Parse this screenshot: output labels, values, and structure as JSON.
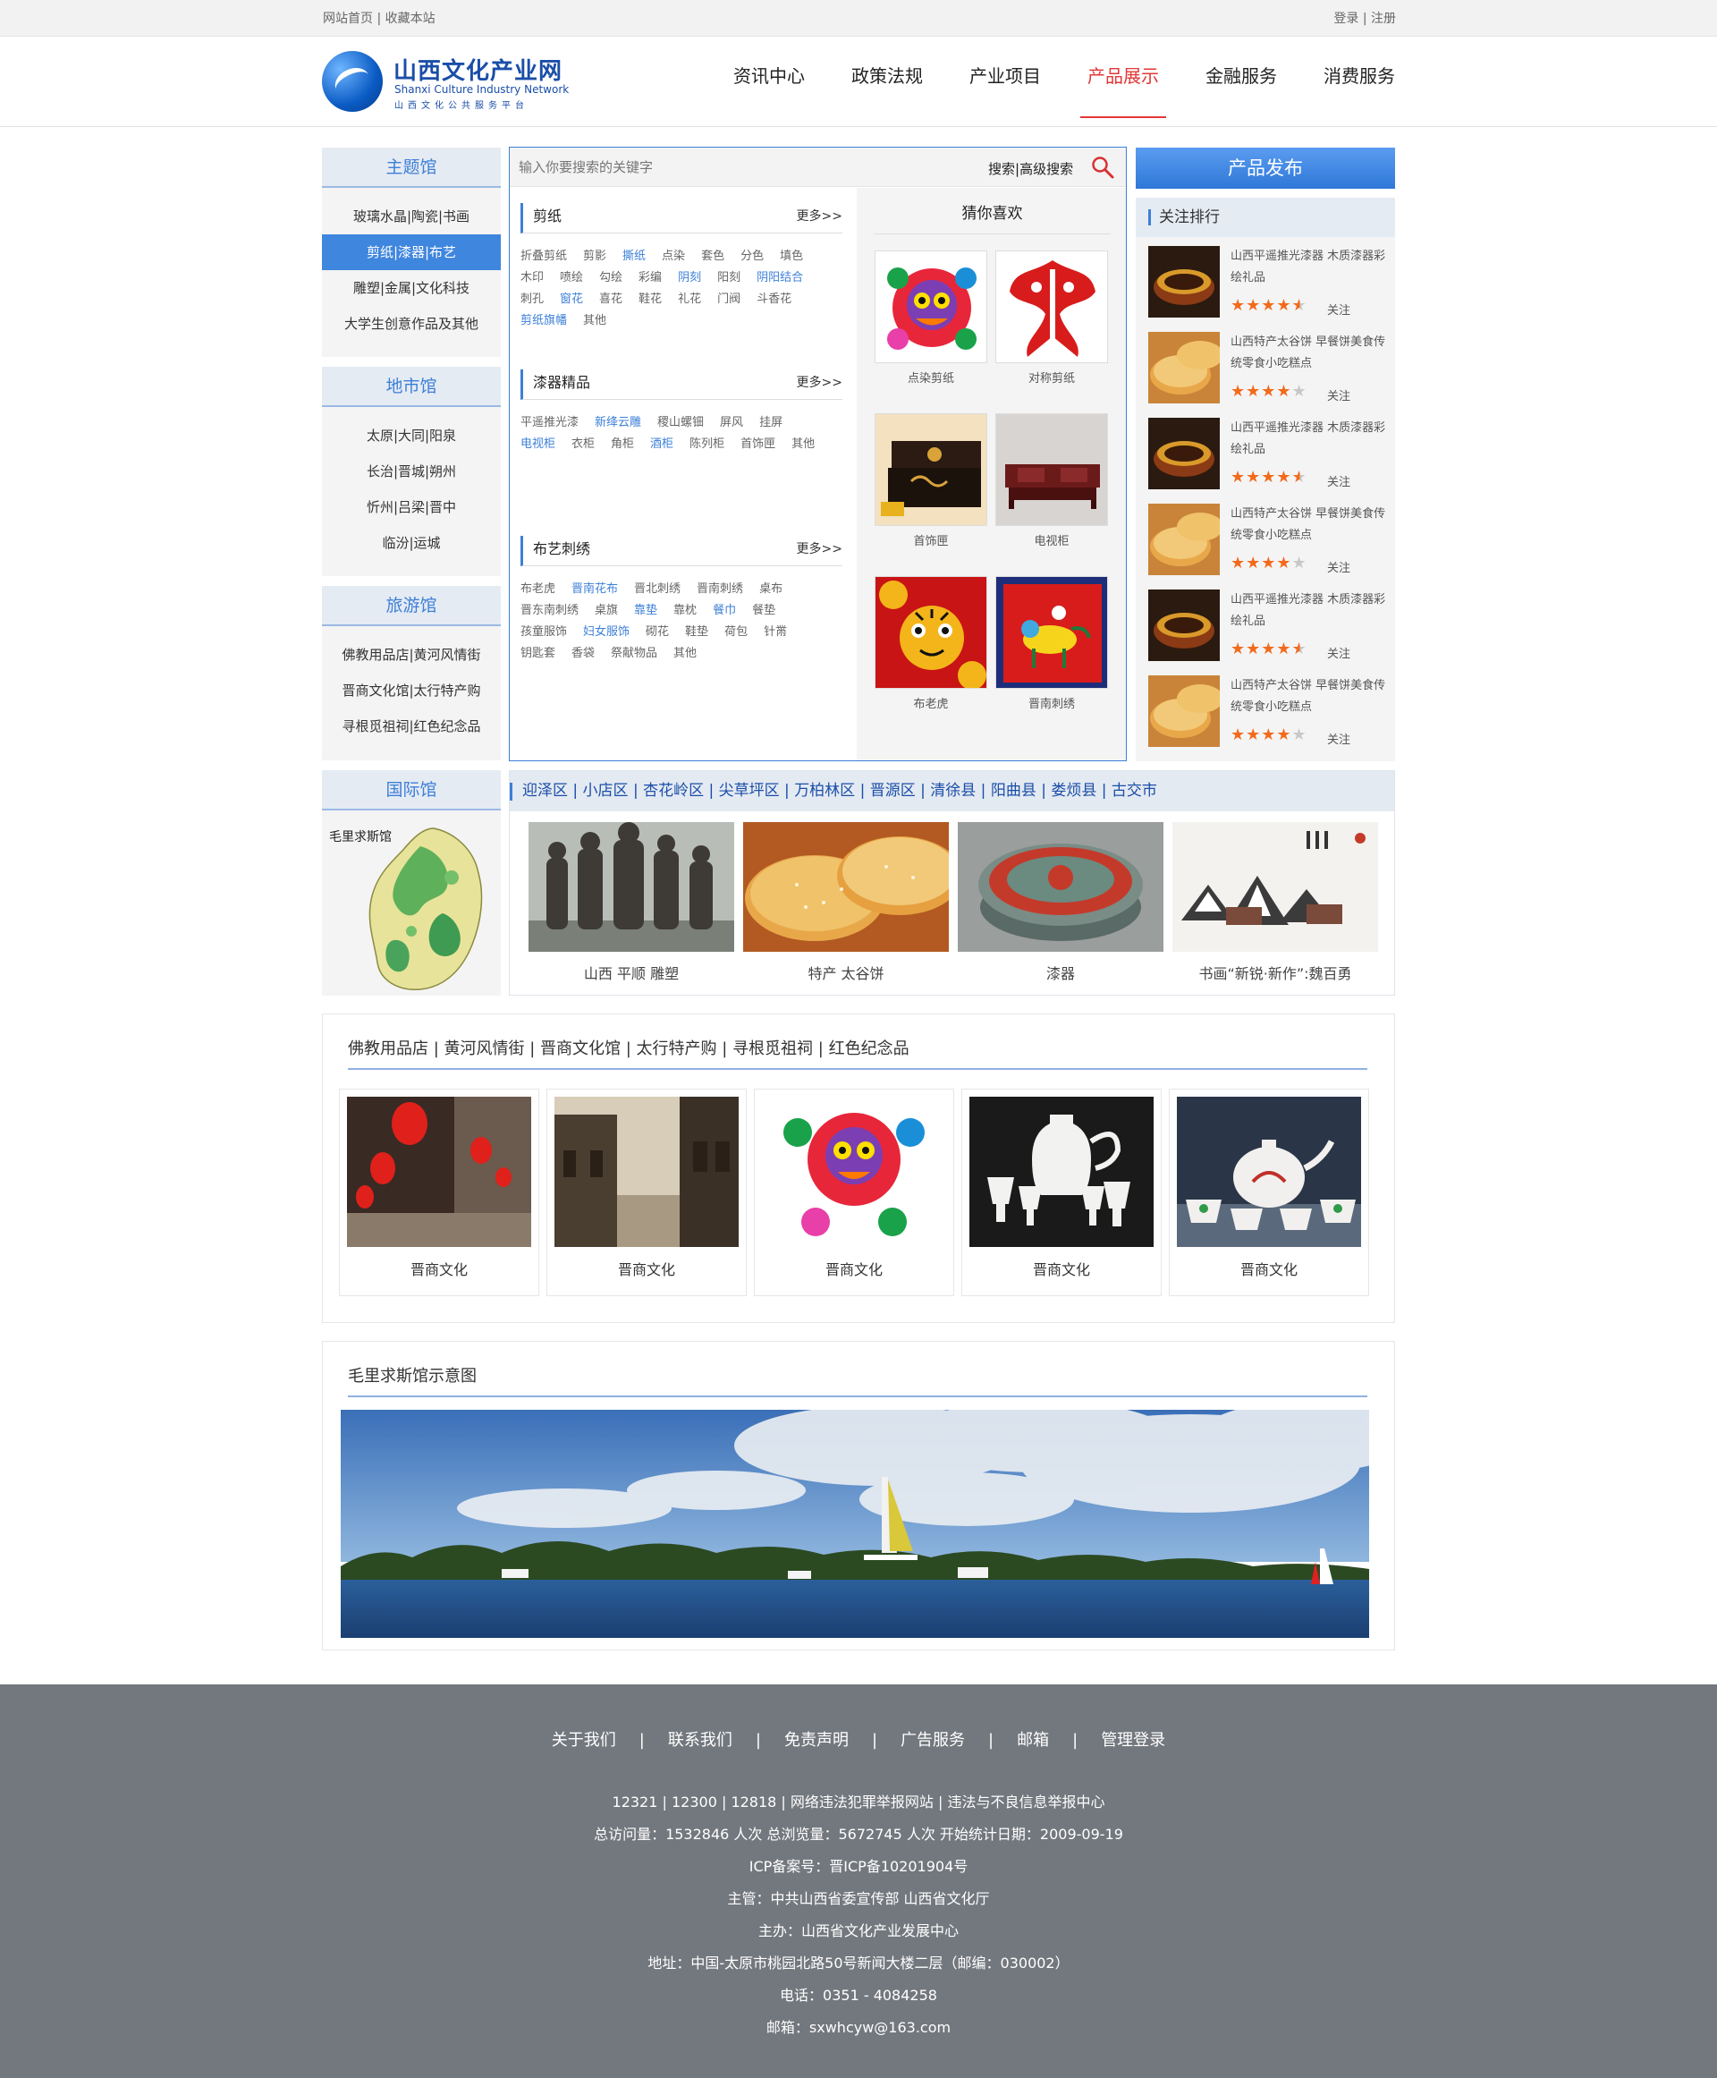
{
  "topbar": {
    "home": "网站首页",
    "sep": "|",
    "favorite": "收藏本站",
    "login": "登录",
    "register": "注册"
  },
  "logo": {
    "cn": "山西文化产业网",
    "en": "Shanxi Culture Industry Network",
    "sub": "山西文化公共服务平台"
  },
  "nav": [
    "资讯中心",
    "政策法规",
    "产业项目",
    "产品展示",
    "金融服务",
    "消费服务"
  ],
  "nav_active": "产品展示",
  "theme_hall": {
    "title": "主题馆",
    "items": [
      "玻璃水晶|陶瓷|书画",
      "剪纸|漆器|布艺",
      "雕塑|金属|文化科技",
      "大学生创意作品及其他"
    ],
    "active": "剪纸|漆器|布艺"
  },
  "city_hall": {
    "title": "地市馆",
    "items": [
      "太原|大同|阳泉",
      "长治|晋城|朔州",
      "忻州|吕梁|晋中",
      "临汾|运城"
    ]
  },
  "travel_hall": {
    "title": "旅游馆",
    "items": [
      "佛教用品店|黄河风情街",
      "晋商文化馆|太行特产购",
      "寻根觅祖祠|红色纪念品"
    ]
  },
  "search": {
    "placeholder": "输入你要搜索的关键字",
    "search": "搜索",
    "sep": "|",
    "advanced": "高级搜索"
  },
  "categories": [
    {
      "title": "剪纸",
      "more": "更多>>",
      "tags": [
        "折叠剪纸",
        "剪影",
        "撕纸",
        "点染",
        "套色",
        "分色",
        "填色",
        "木印",
        "喷绘",
        "勾绘",
        "彩编",
        "阴刻",
        "阳刻",
        "阴阳结合",
        "刺孔",
        "窗花",
        "喜花",
        "鞋花",
        "礼花",
        "门阀",
        "斗香花",
        "剪纸旗幡",
        "其他"
      ],
      "highlight": [
        "撕纸",
        "阴刻",
        "阴阳结合",
        "窗花",
        "剪纸旗幡"
      ]
    },
    {
      "title": "漆器精品",
      "more": "更多>>",
      "tags": [
        "平遥推光漆",
        "新绛云雕",
        "稷山螺钿",
        "屏风",
        "挂屏",
        "电视柜",
        "衣柜",
        "角柜",
        "酒柜",
        "陈列柜",
        "首饰匣",
        "其他"
      ],
      "highlight": [
        "新绛云雕",
        "电视柜",
        "酒柜"
      ]
    },
    {
      "title": "布艺刺绣",
      "more": "更多>>",
      "tags": [
        "布老虎",
        "晋南花布",
        "晋北刺绣",
        "晋南刺绣",
        "桌布",
        "晋东南刺绣",
        "桌旗",
        "靠垫",
        "靠枕",
        "餐巾",
        "餐垫",
        "孩童服饰",
        "妇女服饰",
        "砌花",
        "鞋垫",
        "荷包",
        "针黹",
        "钥匙套",
        "香袋",
        "祭献物品",
        "其他"
      ],
      "highlight": [
        "晋南花布",
        "靠垫",
        "餐巾",
        "妇女服饰"
      ]
    }
  ],
  "guess": {
    "title": "猜你喜欢",
    "items": [
      "点染剪纸",
      "对称剪纸",
      "首饰匣",
      "电视柜",
      "布老虎",
      "晋南刺绣"
    ]
  },
  "publish_button": "产品发布",
  "ranking": {
    "title": "关注排行",
    "follow": "关注",
    "items": [
      {
        "title": "山西平遥推光漆器 木质漆器彩绘礼品",
        "stars": 4.5,
        "thumb": "lacquer"
      },
      {
        "title": "山西特产太谷饼 早餐饼美食传统零食小吃糕点",
        "stars": 4,
        "thumb": "cake"
      },
      {
        "title": "山西平遥推光漆器 木质漆器彩绘礼品",
        "stars": 4.5,
        "thumb": "lacquer"
      },
      {
        "title": "山西特产太谷饼 早餐饼美食传统零食小吃糕点",
        "stars": 4,
        "thumb": "cake"
      },
      {
        "title": "山西平遥推光漆器 木质漆器彩绘礼品",
        "stars": 4.5,
        "thumb": "lacquer"
      },
      {
        "title": "山西特产太谷饼 早餐饼美食传统零食小吃糕点",
        "stars": 4,
        "thumb": "cake"
      }
    ]
  },
  "intl_hall": {
    "title": "国际馆",
    "label": "毛里求斯馆"
  },
  "districts": {
    "items": [
      "迎泽区",
      "小店区",
      "杏花岭区",
      "尖草坪区",
      "万柏林区",
      "晋源区",
      "清徐县",
      "阳曲县",
      "娄烦县",
      "古交市"
    ],
    "pictures": [
      "山西 平顺 雕塑",
      "特产 太谷饼",
      "漆器",
      "书画“新锐·新作”:魏百勇"
    ]
  },
  "culture": {
    "links": [
      "佛教用品店",
      "黄河风情街",
      "晋商文化馆",
      "太行特产购",
      "寻根觅祖祠",
      "红色纪念品"
    ],
    "cards": [
      "晋商文化",
      "晋商文化",
      "晋商文化",
      "晋商文化",
      "晋商文化"
    ]
  },
  "map_section": {
    "title": "毛里求斯馆示意图"
  },
  "footer": {
    "links": [
      "关于我们",
      "联系我们",
      "免责声明",
      "广告服务",
      "邮箱",
      "管理登录"
    ],
    "lines": [
      "12321 | 12300 | 12818 | 网络违法犯罪举报网站 | 违法与不良信息举报中心",
      "总访问量：1532846 人次  总浏览量：5672745 人次  开始统计日期：2009-09-19",
      "ICP备案号：晋ICP备10201904号",
      "主管：中共山西省委宣传部 山西省文化厅",
      "主办：山西省文化产业发展中心",
      "地址：中国-太原市桃园北路50号新闻大楼二层（邮编：030002）",
      "电话：0351 - 4084258",
      "邮箱：sxwhcyw@163.com"
    ]
  },
  "colors": {
    "accent": "#3d7fd8",
    "nav_active": "#e23737",
    "star": "#f26a1b",
    "footer_bg": "#73787e"
  }
}
